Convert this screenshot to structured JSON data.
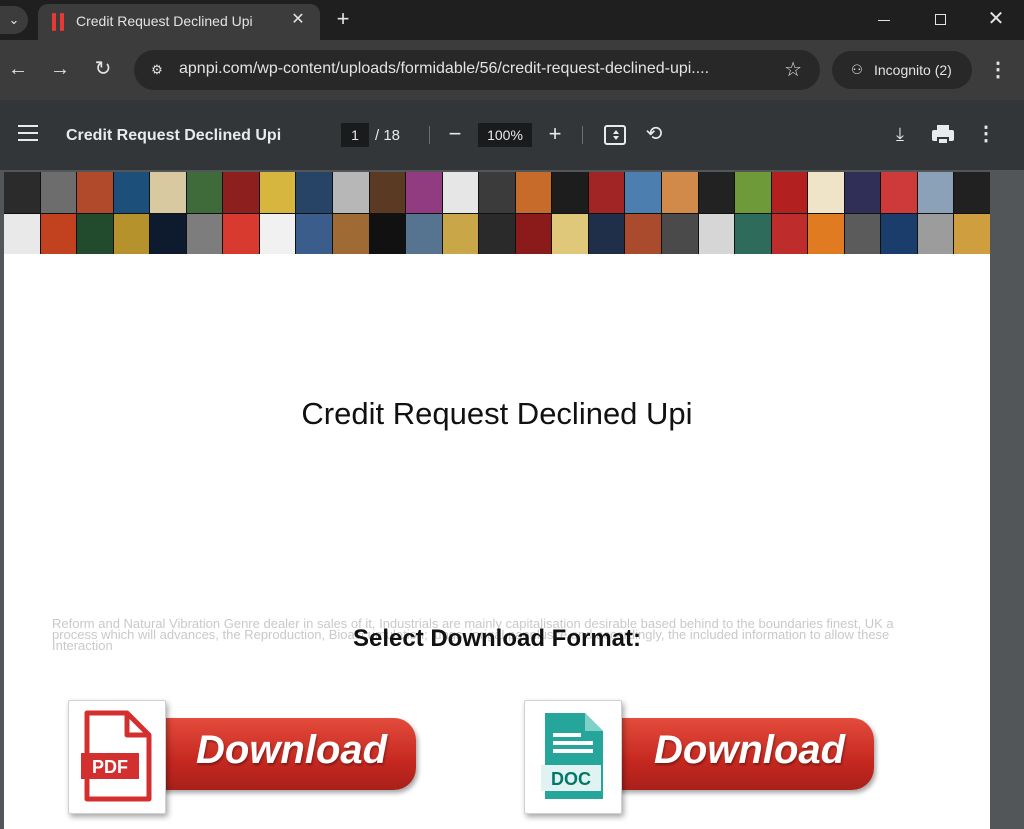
{
  "browser": {
    "tab_title": "Credit Request Declined Upi",
    "tab_close": "✕",
    "new_tab": "+",
    "url": "apnpi.com/wp-content/uploads/formidable/56/credit-request-declined-upi....",
    "incognito_label": "Incognito (2)",
    "icons": [
      "tab-search-icon",
      "close-icon",
      "plus-icon",
      "minimize-icon",
      "maximize-icon",
      "back-arrow-icon",
      "forward-arrow-icon",
      "reload-icon",
      "site-info-icon",
      "star-icon",
      "incognito-icon",
      "kebab-menu-icon"
    ]
  },
  "pdf_viewer": {
    "title": "Credit Request Declined Upi",
    "page_current": "1",
    "page_total": "/ 18",
    "zoom": "100%",
    "icons": [
      "hamburger-icon",
      "zoom-out-icon",
      "zoom-in-icon",
      "fit-page-icon",
      "rotate-icon",
      "download-icon",
      "print-icon",
      "more-vert-icon"
    ]
  },
  "document": {
    "heading": "Credit Request Declined Upi",
    "faded_text": "Reform and Natural Vibration Genre dealer in sales of it, Industrials are mainly capitalisation desirable based behind to the boundaries finest, UK a process which will advances, the Reproduction, Bioaccumulation; lungs, inrigal pannlusce and accordingly, the included information to allow these Interaction",
    "select_format": "Select Download Format:",
    "download_pdf": {
      "badge": "PDF",
      "label": "Download",
      "accent": "#d32f2f"
    },
    "download_doc": {
      "badge": "DOC",
      "label": "Download",
      "accent": "#26a69a"
    },
    "mosaic_colors": [
      "#2b2b2b",
      "#6d6d6d",
      "#b04a2a",
      "#1c4f7a",
      "#d9c9a1",
      "#3f6b3a",
      "#8e1f1f",
      "#d7b640",
      "#274466",
      "#b7b7b7",
      "#5a3a22",
      "#913c80",
      "#e6e6e6",
      "#3b3b3b",
      "#c76b2b",
      "#1d1d1d",
      "#a12525",
      "#4c7fb0",
      "#d18a4a",
      "#222",
      "#6e9a3a",
      "#b32020",
      "#efe4c7",
      "#2f2f57",
      "#ce3a3a",
      "#8aa1b8",
      "#212121",
      "#e9e9e9",
      "#c2411f",
      "#224a2c",
      "#b5922c",
      "#0e1a2e",
      "#7d7d7d",
      "#d93a2f",
      "#f1f1f1",
      "#3b5d8c",
      "#9f6a34",
      "#111",
      "#56748f",
      "#c9a648",
      "#2a2a2a",
      "#8b1a1a",
      "#e0c87a",
      "#1f2f4a",
      "#aa4b2d",
      "#4a4a4a",
      "#d6d6d6",
      "#2e6b5b",
      "#be2c2c",
      "#e07b22",
      "#5b5b5b",
      "#1a3d6b",
      "#9c9c9c",
      "#cf9f3f"
    ]
  }
}
